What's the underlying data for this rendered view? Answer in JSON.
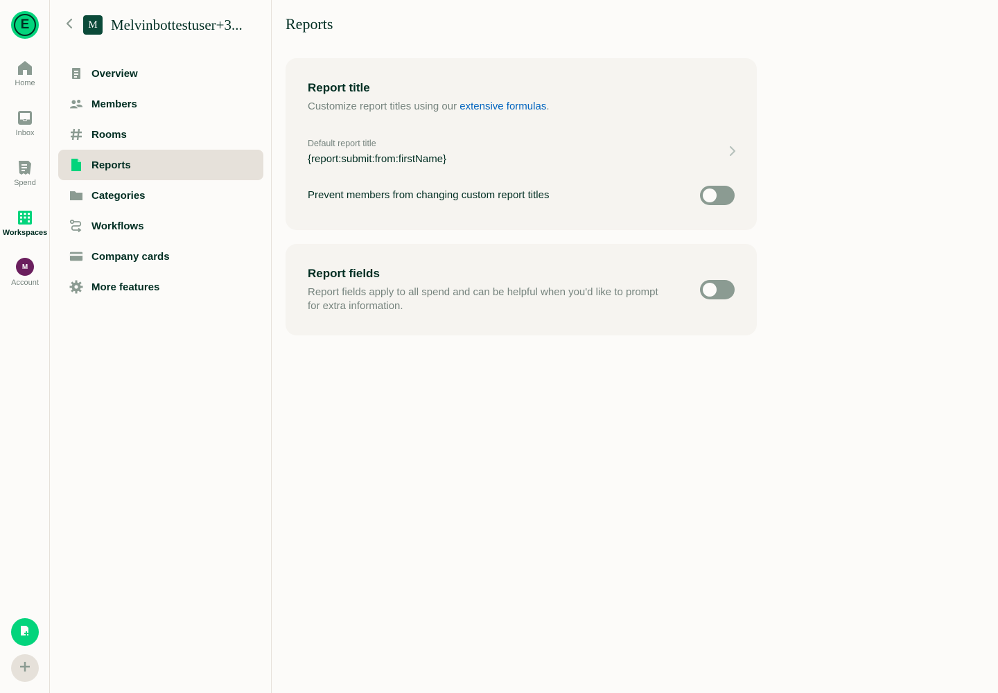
{
  "rail": {
    "logo_letter": "E",
    "items": [
      {
        "label": "Home",
        "icon": "home-icon"
      },
      {
        "label": "Inbox",
        "icon": "inbox-icon"
      },
      {
        "label": "Spend",
        "icon": "receipt-icon"
      },
      {
        "label": "Workspaces",
        "icon": "building-icon"
      },
      {
        "label": "Account",
        "icon": "avatar"
      }
    ],
    "account_initial": "M",
    "active": "Workspaces"
  },
  "workspace": {
    "avatar_letter": "M",
    "name": "Melvinbottestuser+3...",
    "menu": [
      {
        "label": "Overview",
        "icon": "document-icon"
      },
      {
        "label": "Members",
        "icon": "users-icon"
      },
      {
        "label": "Rooms",
        "icon": "hashtag-icon"
      },
      {
        "label": "Reports",
        "icon": "file-icon"
      },
      {
        "label": "Categories",
        "icon": "folder-icon"
      },
      {
        "label": "Workflows",
        "icon": "workflow-icon"
      },
      {
        "label": "Company cards",
        "icon": "card-icon"
      },
      {
        "label": "More features",
        "icon": "gear-icon"
      }
    ],
    "active": "Reports"
  },
  "page": {
    "title": "Reports",
    "report_title_card": {
      "title": "Report title",
      "desc_prefix": "Customize report titles using our ",
      "desc_link": "extensive formulas",
      "desc_suffix": ".",
      "field_label": "Default report title",
      "field_value": "{report:submit:from:firstName}",
      "toggle_label": "Prevent members from changing custom report titles",
      "toggle_on": false
    },
    "report_fields_card": {
      "title": "Report fields",
      "desc": "Report fields apply to all spend and can be helpful when you'd like to prompt for extra information.",
      "toggle_on": false
    }
  },
  "colors": {
    "brand_green": "#03d47c",
    "text_dark": "#002e22",
    "text_muted": "#76847e",
    "link": "#0164bf",
    "toggle_off": "#8b9b92",
    "card_bg": "#f6f4f0",
    "active_item_bg": "#e6e1da"
  }
}
